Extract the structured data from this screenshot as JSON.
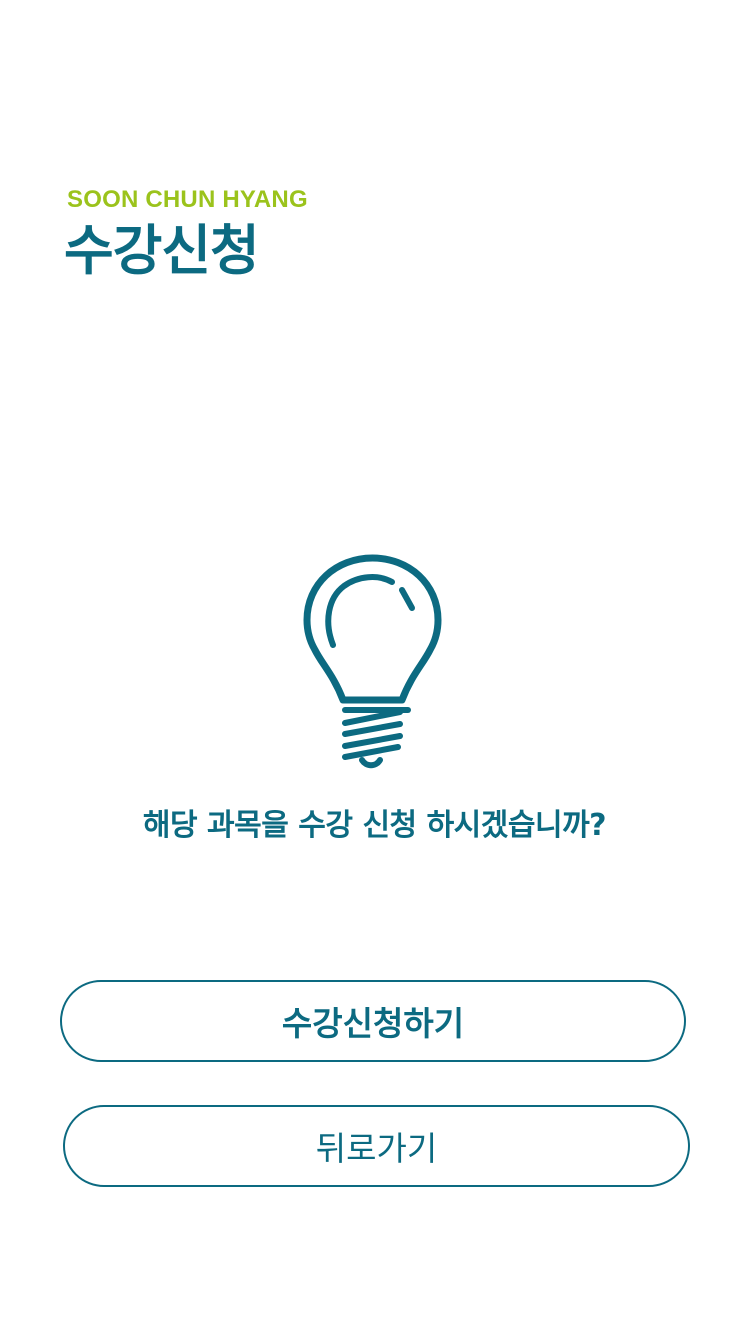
{
  "header": {
    "brand": "SOON CHUN HYANG",
    "title": "수강신청"
  },
  "dialog": {
    "icon": "lightbulb-icon",
    "message": "해당 과목을 수강 신청 하시겠습니까?"
  },
  "actions": {
    "confirm_label": "수강신청하기",
    "back_label": "뒤로가기"
  },
  "colors": {
    "primary": "#0c6a81",
    "brand_accent": "#9bc31c",
    "background": "#ffffff"
  }
}
